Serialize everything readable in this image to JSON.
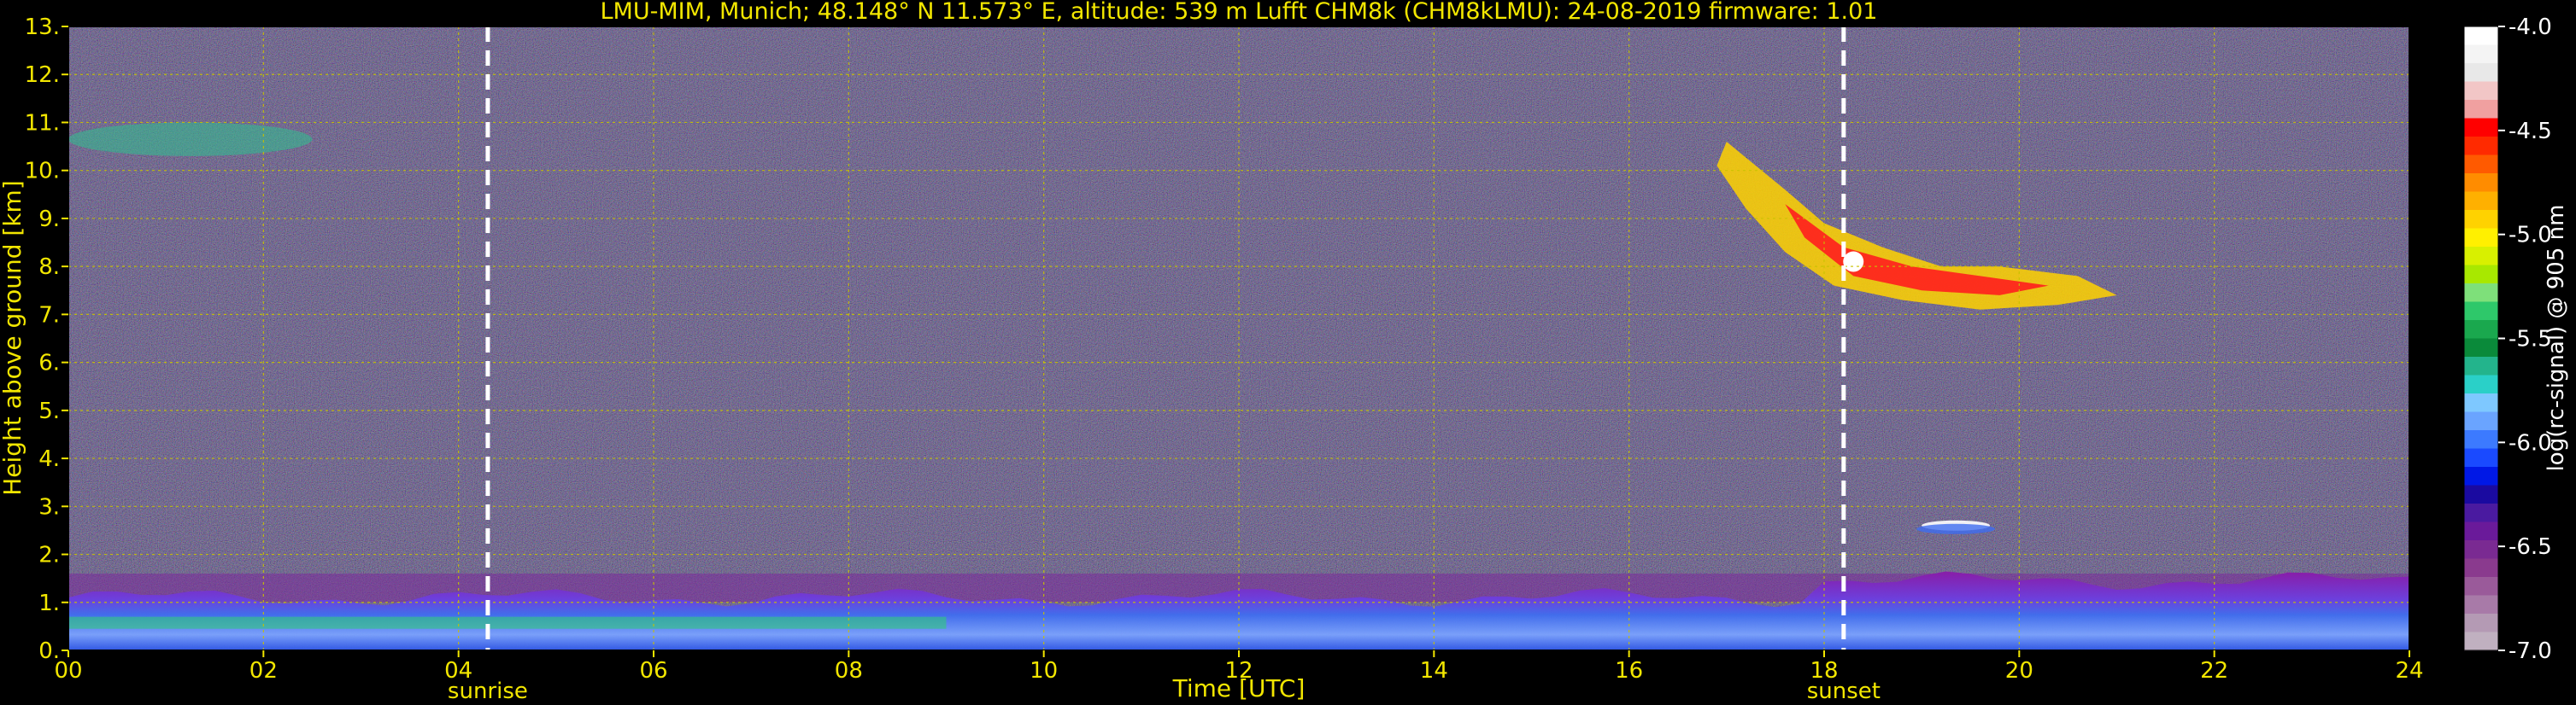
{
  "chart_data": {
    "type": "heatmap",
    "title": "LMU-MIM, Munich; 48.148° N 11.573° E, altitude: 539 m    Lufft CHM8k (CHM8kLMU): 24-08-2019    firmware: 1.01",
    "xlabel": "Time [UTC]",
    "ylabel": "Height above ground [km]",
    "xlim": [
      0,
      24
    ],
    "ylim": [
      0,
      13
    ],
    "x_ticks": [
      "00",
      "02",
      "04",
      "06",
      "08",
      "10",
      "12",
      "14",
      "16",
      "18",
      "20",
      "22",
      "24"
    ],
    "y_ticks": [
      "0.",
      "1.",
      "2.",
      "3.",
      "4.",
      "5.",
      "6.",
      "7.",
      "8.",
      "9.",
      "10.",
      "11.",
      "12.",
      "13."
    ],
    "grid": true,
    "events": [
      {
        "label": "sunrise",
        "time": 4.3
      },
      {
        "label": "sunset",
        "time": 18.2
      }
    ],
    "colorbar": {
      "label": "log(rc-signal) @ 905 nm",
      "range": [
        -7.0,
        -4.0
      ],
      "ticks": [
        "-4.0",
        "-4.5",
        "-5.0",
        "-5.5",
        "-6.0",
        "-6.5",
        "-7.0"
      ]
    },
    "features": [
      {
        "name": "boundary layer",
        "time_range": [
          0,
          24
        ],
        "height_km": [
          0,
          1.1
        ]
      },
      {
        "name": "cirrus cloud",
        "time_range": [
          17.0,
          21.0
        ],
        "height_km": [
          7.0,
          10.5
        ]
      },
      {
        "name": "thin cloud",
        "time_range": [
          19.0,
          19.7
        ],
        "height_km": [
          2.5,
          2.7
        ]
      },
      {
        "name": "aerosol layer",
        "time_range": [
          0,
          2.5
        ],
        "height_km": [
          10.3,
          11.0
        ]
      }
    ]
  },
  "colors": {
    "background": "#000000",
    "text": "#f2e600",
    "grid": "#c8c200",
    "events": "#ffffff",
    "colorbar_text": "#ffffff"
  }
}
